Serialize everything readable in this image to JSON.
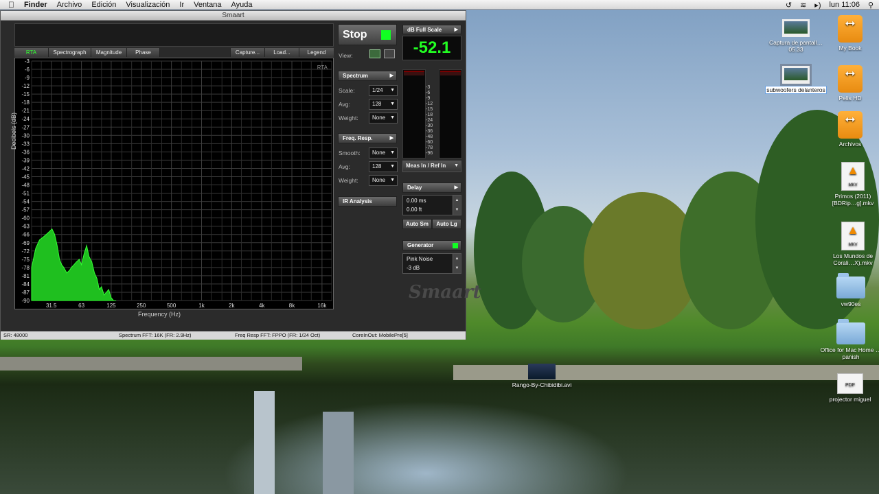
{
  "menubar": {
    "apple": "",
    "app": "Finder",
    "items": [
      "Archivo",
      "Edición",
      "Visualización",
      "Ir",
      "Ventana",
      "Ayuda"
    ],
    "clock": "lun 11:06",
    "icons": [
      "time-machine-icon",
      "wifi-icon",
      "volume-icon",
      "spotlight-icon"
    ]
  },
  "window": {
    "title": "Smaart",
    "tabs": [
      "RTA",
      "Spectrograph",
      "Magnitude",
      "Phase",
      "Capture...",
      "Load...",
      "Legend"
    ],
    "active_tab": "RTA",
    "plot_label": "RTA",
    "y_title": "Decibels (dB)",
    "x_title": "Frequency (Hz)"
  },
  "chart_data": {
    "type": "area",
    "title": "",
    "xlabel": "Frequency (Hz)",
    "ylabel": "Decibels (dB)",
    "x_scale": "log",
    "xlim": [
      20,
      20000
    ],
    "ylim": [
      -90,
      -3
    ],
    "x_ticks": [
      "31.5",
      "63",
      "125",
      "250",
      "500",
      "1k",
      "2k",
      "4k",
      "8k",
      "16k"
    ],
    "y_ticks": [
      "-3",
      "-6",
      "-9",
      "-12",
      "-15",
      "-18",
      "-21",
      "-24",
      "-27",
      "-30",
      "-33",
      "-36",
      "-39",
      "-42",
      "-45",
      "-48",
      "-51",
      "-54",
      "-57",
      "-60",
      "-63",
      "-66",
      "-69",
      "-72",
      "-75",
      "-78",
      "-81",
      "-84",
      "-87",
      "-90"
    ],
    "grid": true,
    "series": [
      {
        "color": "#1fbf1f",
        "x": [
          20,
          22,
          24,
          26,
          28,
          30,
          32,
          34,
          36,
          38,
          40,
          42,
          45,
          48,
          50,
          53,
          56,
          60,
          63,
          67,
          71,
          75,
          80,
          85,
          90,
          95,
          100,
          106,
          112,
          118,
          125,
          132,
          140
        ],
        "y": [
          -78,
          -71,
          -68,
          -67,
          -66,
          -65,
          -64,
          -66,
          -70,
          -75,
          -77,
          -78,
          -80,
          -79,
          -78,
          -77,
          -76,
          -75,
          -77,
          -73,
          -70,
          -74,
          -76,
          -80,
          -82,
          -86,
          -85,
          -88,
          -87,
          -86,
          -89,
          -90,
          -90
        ]
      }
    ]
  },
  "controls": {
    "stop_label": "Stop",
    "stop_color": "#1f2",
    "view_label": "View:",
    "spectrum": {
      "label": "Spectrum",
      "scale_label": "Scale:",
      "scale": "1/24",
      "avg_label": "Avg:",
      "avg": "128",
      "weight_label": "Weight:",
      "weight": "None"
    },
    "freq_resp": {
      "label": "Freq. Resp.",
      "smooth_label": "Smooth:",
      "smooth": "None",
      "avg_label": "Avg:",
      "avg": "128",
      "weight_label": "Weight:",
      "weight": "None"
    },
    "ir_analysis": "IR Analysis",
    "db_scale": "dB Full Scale",
    "db_value": "-52.1",
    "meter_scale": [
      "-3",
      "-6",
      "-9",
      "-12",
      "-15",
      "-18",
      "-24",
      "-30",
      "-36",
      "-48",
      "-60",
      "-78",
      "-96"
    ],
    "meas_in": "Meas In / Ref In",
    "delay": {
      "label": "Delay",
      "ms": "0.00 ms",
      "ft": "0.00 ft",
      "auto_sm": "Auto Sm",
      "auto_lg": "Auto Lg"
    },
    "generator": {
      "label": "Generator",
      "signal": "Pink Noise",
      "level": "-3 dB"
    },
    "logo": "Smaart"
  },
  "status": {
    "sr": "SR: 48000",
    "spectrum_fft": "Spectrum FFT: 16K (FR: 2.9Hz)",
    "freq_resp_fft": "Freq Resp FFT: FPPO (FR: 1/24 Oct)",
    "core": "CoreInOut: MobilePre[5]"
  },
  "desktop": {
    "icons": [
      {
        "label": "Captura de pantall…05.33",
        "kind": "screenshot"
      },
      {
        "label": "My Book",
        "kind": "drive"
      },
      {
        "label": "subwoofers delanteros",
        "kind": "screenshot",
        "selected": true
      },
      {
        "label": "Pelis HD",
        "kind": "drive"
      },
      {
        "label": "Archivos",
        "kind": "drive"
      },
      {
        "label": "Primos (2011) [BDRip…g].mkv",
        "kind": "mkv"
      },
      {
        "label": "Los Mundos de Corali…X).mkv",
        "kind": "mkv"
      },
      {
        "label": "vw90es",
        "kind": "folder"
      },
      {
        "label": "Office for Mac Home …panish",
        "kind": "folder"
      },
      {
        "label": "projector miguel",
        "kind": "pdf"
      },
      {
        "label": "Rango-By-Chibidibi.avi",
        "kind": "video"
      }
    ],
    "mkv_badge": "MKV",
    "pdf_badge": "PDF"
  }
}
